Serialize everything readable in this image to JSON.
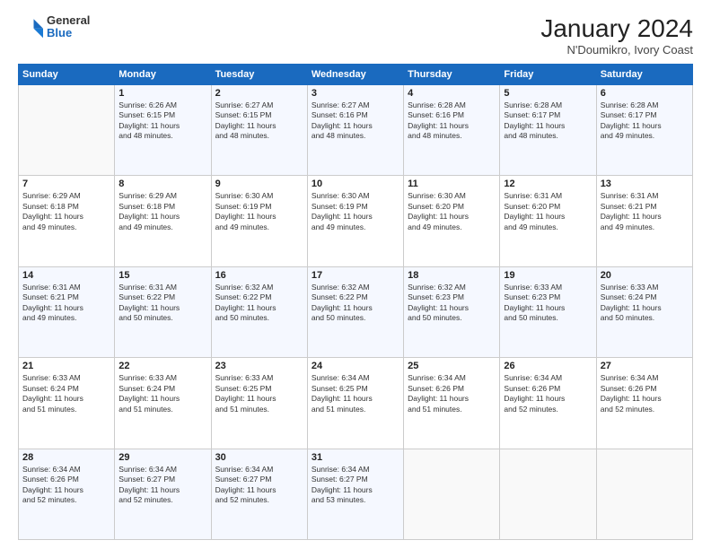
{
  "header": {
    "logo_general": "General",
    "logo_blue": "Blue",
    "month_year": "January 2024",
    "location": "N'Doumikro, Ivory Coast"
  },
  "days_of_week": [
    "Sunday",
    "Monday",
    "Tuesday",
    "Wednesday",
    "Thursday",
    "Friday",
    "Saturday"
  ],
  "weeks": [
    [
      {
        "day": "",
        "info": ""
      },
      {
        "day": "1",
        "info": "Sunrise: 6:26 AM\nSunset: 6:15 PM\nDaylight: 11 hours\nand 48 minutes."
      },
      {
        "day": "2",
        "info": "Sunrise: 6:27 AM\nSunset: 6:15 PM\nDaylight: 11 hours\nand 48 minutes."
      },
      {
        "day": "3",
        "info": "Sunrise: 6:27 AM\nSunset: 6:16 PM\nDaylight: 11 hours\nand 48 minutes."
      },
      {
        "day": "4",
        "info": "Sunrise: 6:28 AM\nSunset: 6:16 PM\nDaylight: 11 hours\nand 48 minutes."
      },
      {
        "day": "5",
        "info": "Sunrise: 6:28 AM\nSunset: 6:17 PM\nDaylight: 11 hours\nand 48 minutes."
      },
      {
        "day": "6",
        "info": "Sunrise: 6:28 AM\nSunset: 6:17 PM\nDaylight: 11 hours\nand 49 minutes."
      }
    ],
    [
      {
        "day": "7",
        "info": "Sunrise: 6:29 AM\nSunset: 6:18 PM\nDaylight: 11 hours\nand 49 minutes."
      },
      {
        "day": "8",
        "info": "Sunrise: 6:29 AM\nSunset: 6:18 PM\nDaylight: 11 hours\nand 49 minutes."
      },
      {
        "day": "9",
        "info": "Sunrise: 6:30 AM\nSunset: 6:19 PM\nDaylight: 11 hours\nand 49 minutes."
      },
      {
        "day": "10",
        "info": "Sunrise: 6:30 AM\nSunset: 6:19 PM\nDaylight: 11 hours\nand 49 minutes."
      },
      {
        "day": "11",
        "info": "Sunrise: 6:30 AM\nSunset: 6:20 PM\nDaylight: 11 hours\nand 49 minutes."
      },
      {
        "day": "12",
        "info": "Sunrise: 6:31 AM\nSunset: 6:20 PM\nDaylight: 11 hours\nand 49 minutes."
      },
      {
        "day": "13",
        "info": "Sunrise: 6:31 AM\nSunset: 6:21 PM\nDaylight: 11 hours\nand 49 minutes."
      }
    ],
    [
      {
        "day": "14",
        "info": "Sunrise: 6:31 AM\nSunset: 6:21 PM\nDaylight: 11 hours\nand 49 minutes."
      },
      {
        "day": "15",
        "info": "Sunrise: 6:31 AM\nSunset: 6:22 PM\nDaylight: 11 hours\nand 50 minutes."
      },
      {
        "day": "16",
        "info": "Sunrise: 6:32 AM\nSunset: 6:22 PM\nDaylight: 11 hours\nand 50 minutes."
      },
      {
        "day": "17",
        "info": "Sunrise: 6:32 AM\nSunset: 6:22 PM\nDaylight: 11 hours\nand 50 minutes."
      },
      {
        "day": "18",
        "info": "Sunrise: 6:32 AM\nSunset: 6:23 PM\nDaylight: 11 hours\nand 50 minutes."
      },
      {
        "day": "19",
        "info": "Sunrise: 6:33 AM\nSunset: 6:23 PM\nDaylight: 11 hours\nand 50 minutes."
      },
      {
        "day": "20",
        "info": "Sunrise: 6:33 AM\nSunset: 6:24 PM\nDaylight: 11 hours\nand 50 minutes."
      }
    ],
    [
      {
        "day": "21",
        "info": "Sunrise: 6:33 AM\nSunset: 6:24 PM\nDaylight: 11 hours\nand 51 minutes."
      },
      {
        "day": "22",
        "info": "Sunrise: 6:33 AM\nSunset: 6:24 PM\nDaylight: 11 hours\nand 51 minutes."
      },
      {
        "day": "23",
        "info": "Sunrise: 6:33 AM\nSunset: 6:25 PM\nDaylight: 11 hours\nand 51 minutes."
      },
      {
        "day": "24",
        "info": "Sunrise: 6:34 AM\nSunset: 6:25 PM\nDaylight: 11 hours\nand 51 minutes."
      },
      {
        "day": "25",
        "info": "Sunrise: 6:34 AM\nSunset: 6:26 PM\nDaylight: 11 hours\nand 51 minutes."
      },
      {
        "day": "26",
        "info": "Sunrise: 6:34 AM\nSunset: 6:26 PM\nDaylight: 11 hours\nand 52 minutes."
      },
      {
        "day": "27",
        "info": "Sunrise: 6:34 AM\nSunset: 6:26 PM\nDaylight: 11 hours\nand 52 minutes."
      }
    ],
    [
      {
        "day": "28",
        "info": "Sunrise: 6:34 AM\nSunset: 6:26 PM\nDaylight: 11 hours\nand 52 minutes."
      },
      {
        "day": "29",
        "info": "Sunrise: 6:34 AM\nSunset: 6:27 PM\nDaylight: 11 hours\nand 52 minutes."
      },
      {
        "day": "30",
        "info": "Sunrise: 6:34 AM\nSunset: 6:27 PM\nDaylight: 11 hours\nand 52 minutes."
      },
      {
        "day": "31",
        "info": "Sunrise: 6:34 AM\nSunset: 6:27 PM\nDaylight: 11 hours\nand 53 minutes."
      },
      {
        "day": "",
        "info": ""
      },
      {
        "day": "",
        "info": ""
      },
      {
        "day": "",
        "info": ""
      }
    ]
  ]
}
